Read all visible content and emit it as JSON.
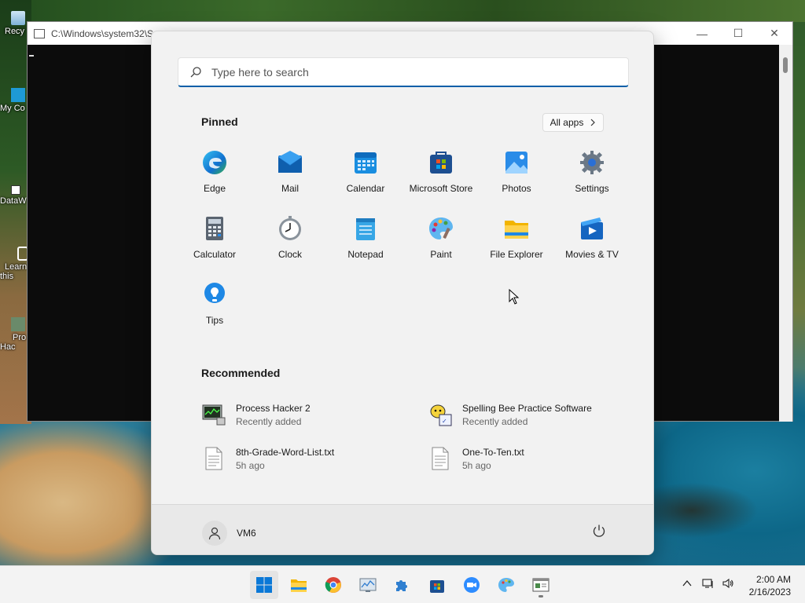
{
  "console": {
    "title": "C:\\Windows\\system32\\S"
  },
  "desktop_icons": [
    {
      "label": "Recy",
      "name": "recycle-bin"
    },
    {
      "label": "My Co",
      "name": "my-computer"
    },
    {
      "label": "DataW",
      "name": "datawarehouse"
    },
    {
      "label": "Learn this",
      "name": "learn"
    },
    {
      "label": "Pro Hac",
      "name": "process-hacker"
    }
  ],
  "start_menu": {
    "search_placeholder": "Type here to search",
    "pinned_title": "Pinned",
    "all_apps_label": "All apps",
    "pinned": [
      {
        "label": "Edge",
        "icon": "edge-icon"
      },
      {
        "label": "Mail",
        "icon": "mail-icon"
      },
      {
        "label": "Calendar",
        "icon": "calendar-icon"
      },
      {
        "label": "Microsoft Store",
        "icon": "store-icon"
      },
      {
        "label": "Photos",
        "icon": "photos-icon"
      },
      {
        "label": "Settings",
        "icon": "settings-icon"
      },
      {
        "label": "Calculator",
        "icon": "calculator-icon"
      },
      {
        "label": "Clock",
        "icon": "clock-icon"
      },
      {
        "label": "Notepad",
        "icon": "notepad-icon"
      },
      {
        "label": "Paint",
        "icon": "paint-icon"
      },
      {
        "label": "File Explorer",
        "icon": "folder-icon"
      },
      {
        "label": "Movies & TV",
        "icon": "movies-icon"
      },
      {
        "label": "Tips",
        "icon": "tips-icon"
      }
    ],
    "recommended_title": "Recommended",
    "recommended": [
      {
        "name": "Process Hacker 2",
        "sub": "Recently added",
        "icon": "process-hacker-icon"
      },
      {
        "name": "Spelling Bee Practice Software",
        "sub": "Recently added",
        "icon": "spelling-bee-icon"
      },
      {
        "name": "8th-Grade-Word-List.txt",
        "sub": "5h ago",
        "icon": "text-file-icon"
      },
      {
        "name": "One-To-Ten.txt",
        "sub": "5h ago",
        "icon": "text-file-icon"
      }
    ],
    "user_name": "VM6"
  },
  "taskbar": {
    "apps": [
      {
        "name": "start",
        "icon": "windows-logo-icon",
        "active": true
      },
      {
        "name": "file-explorer",
        "icon": "folder-icon"
      },
      {
        "name": "chrome",
        "icon": "chrome-icon"
      },
      {
        "name": "resource-monitor",
        "icon": "monitor-chart-icon"
      },
      {
        "name": "app-puzzle",
        "icon": "puzzle-icon"
      },
      {
        "name": "microsoft-store",
        "icon": "store-icon"
      },
      {
        "name": "zoom",
        "icon": "zoom-icon"
      },
      {
        "name": "paint",
        "icon": "paint-icon"
      },
      {
        "name": "console-window",
        "icon": "console-icon",
        "running": true
      }
    ],
    "time": "2:00 AM",
    "date": "2/16/2023"
  },
  "colors": {
    "accent": "#0a5fa8",
    "menu_bg": "#f2f2f2",
    "taskbar_bg": "#f3f3f3"
  }
}
